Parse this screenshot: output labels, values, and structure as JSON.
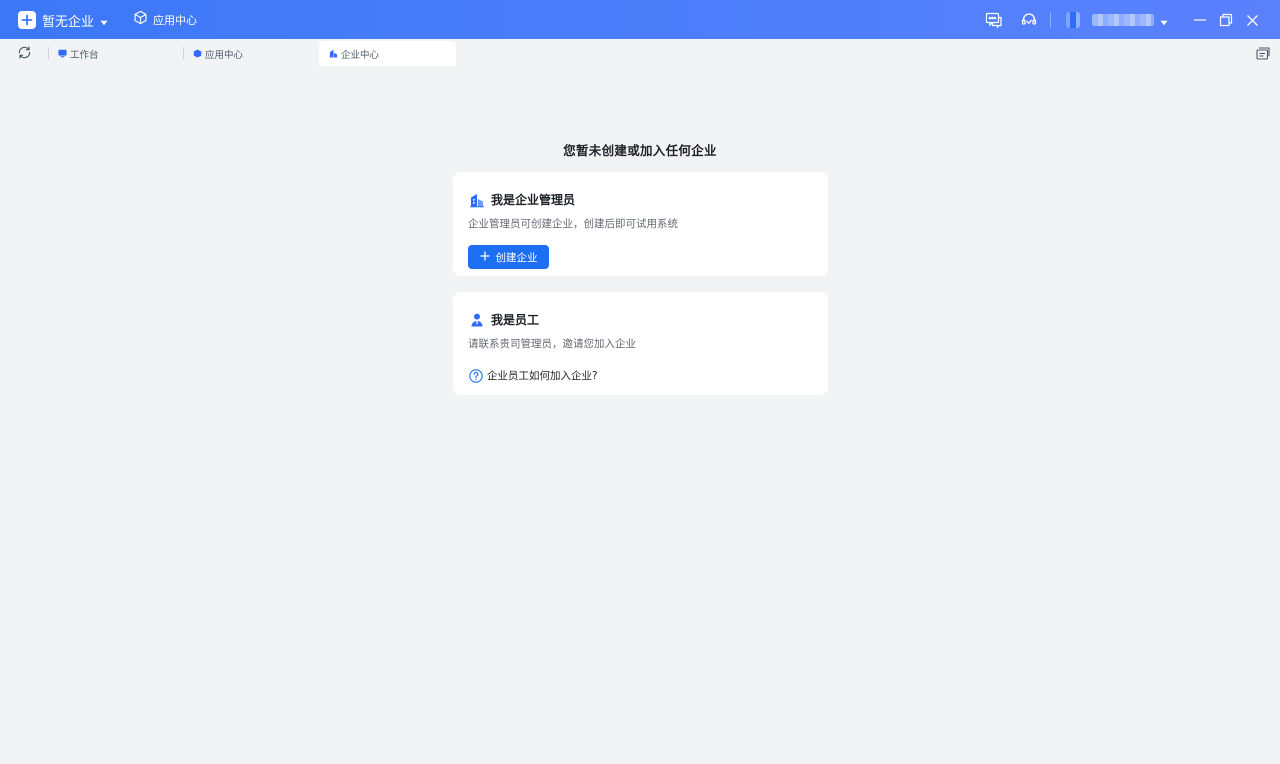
{
  "titlebar": {
    "org_name": "暂无企业",
    "app_center_label": "应用中心"
  },
  "tabs": [
    {
      "label": "工作台",
      "icon": "monitor-icon"
    },
    {
      "label": "应用中心",
      "icon": "cube-icon"
    },
    {
      "label": "企业中心",
      "icon": "building-icon",
      "active": true
    }
  ],
  "main": {
    "title": "您暂未创建或加入任何企业",
    "admin_card": {
      "title": "我是企业管理员",
      "description": "企业管理员可创建企业，创建后即可试用系统",
      "button_label": "创建企业"
    },
    "staff_card": {
      "title": "我是员工",
      "description": "请联系贵司管理员，邀请您加入企业",
      "help_link": "企业员工如何加入企业?"
    }
  },
  "colors": {
    "titlebar_start": "#3c78f7",
    "titlebar_end": "#5a80fc",
    "primary": "#1e6ef4",
    "page_bg": "#f2f3f5"
  }
}
